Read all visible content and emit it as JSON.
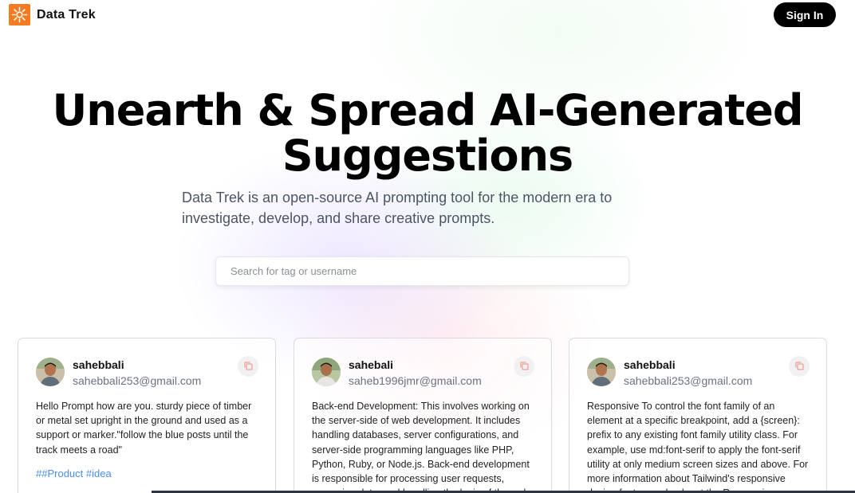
{
  "nav": {
    "brand_name": "Data Trek",
    "logo_icon": "sunburst-logo-icon",
    "logo_color": "#f47b20",
    "signin_label": "Sign In"
  },
  "hero": {
    "title_line1": "Unearth & Spread AI-Generated",
    "title_line2": "Suggestions",
    "description": "Data Trek is an open-source AI prompting tool for the modern era to investigate, develop, and share creative prompts."
  },
  "search": {
    "placeholder": "Search for tag or username",
    "value": ""
  },
  "cards": [
    {
      "username": "sahebbali",
      "email": "sahebbali253@gmail.com",
      "prompt": "Hello Prompt how are you. sturdy piece of timber or metal set upright in the ground and used as a support or marker.\"follow the blue posts until the track meets a road\"",
      "tags": "##Product #idea",
      "copy_icon": "copy-icon"
    },
    {
      "username": "sahebali",
      "email": "saheb1996jmr@gmail.com",
      "prompt": "Back-end Development: This involves working on the server-side of web development. It includes handling databases, server configurations, and server-side programming languages like PHP, Python, Ruby, or Node.js. Back-end development is responsible for processing user requests, managing data, and handling the logic of the web",
      "copy_icon": "copy-icon"
    },
    {
      "username": "sahebbali",
      "email": "sahebbali253@gmail.com",
      "prompt": "Responsive To control the font family of an element at a specific breakpoint, add a {screen}: prefix to any existing font family utility class. For example, use md:font-serif to apply the font-serif utility at only medium screen sizes and above. For more information about Tailwind's responsive design features, check out the Responsive",
      "copy_icon": "copy-icon"
    }
  ],
  "colors": {
    "accent": "#f47b20",
    "tag_link": "#4a8ee6",
    "button_bg": "#000000"
  }
}
